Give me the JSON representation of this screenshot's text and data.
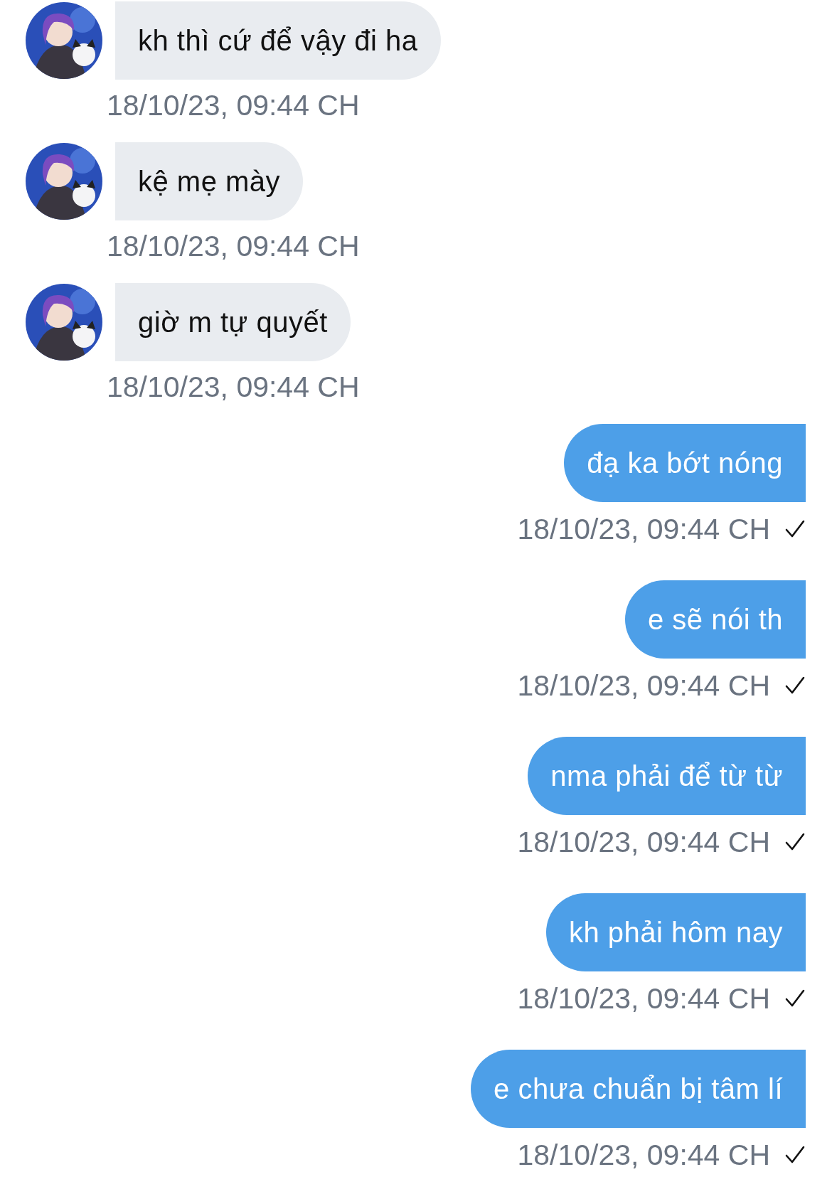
{
  "messages": [
    {
      "kind": "received",
      "text": "kh thì cứ để vậy đi ha",
      "time": "18/10/23, 09:44 CH",
      "sent": false
    },
    {
      "kind": "received",
      "text": "kệ mẹ mày",
      "time": "18/10/23, 09:44 CH",
      "sent": false
    },
    {
      "kind": "received",
      "text": "giờ m tự quyết",
      "time": "18/10/23, 09:44 CH",
      "sent": false
    },
    {
      "kind": "sent",
      "text": "đạ ka bớt nóng",
      "time": "18/10/23, 09:44 CH",
      "sent": true
    },
    {
      "kind": "sent",
      "text": "e sẽ nói th",
      "time": "18/10/23, 09:44 CH",
      "sent": true
    },
    {
      "kind": "sent",
      "text": "nma phải để từ từ",
      "time": "18/10/23, 09:44 CH",
      "sent": true
    },
    {
      "kind": "sent",
      "text": "kh phải hôm nay",
      "time": "18/10/23, 09:44 CH",
      "sent": true
    },
    {
      "kind": "sent",
      "text": "e chưa chuẩn bị tâm lí",
      "time": "18/10/23, 09:44 CH",
      "sent": true
    }
  ]
}
